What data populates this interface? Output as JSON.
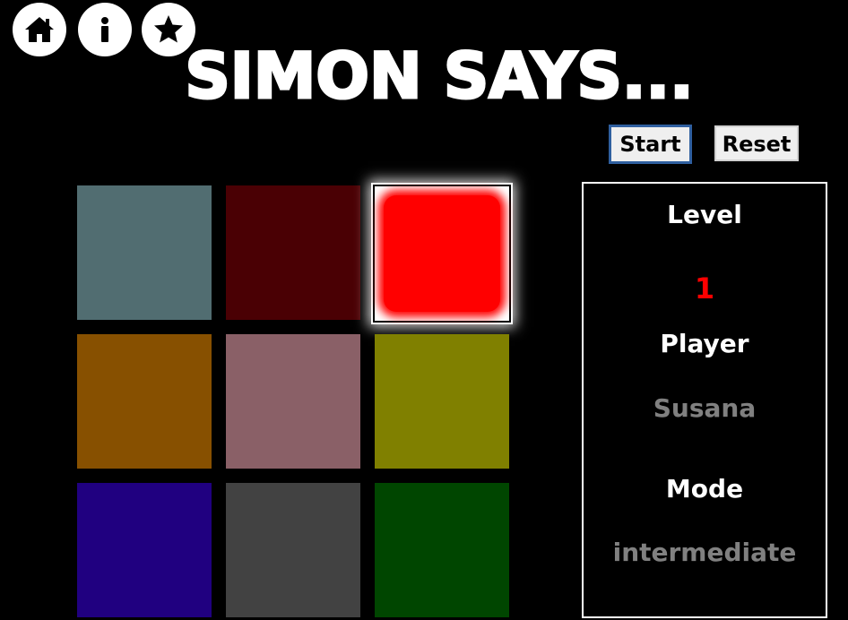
{
  "header": {
    "title": "SIMON SAYS...",
    "nav": [
      {
        "name": "home",
        "icon": "home-icon"
      },
      {
        "name": "info",
        "icon": "info-icon"
      },
      {
        "name": "favorites",
        "icon": "star-icon"
      }
    ]
  },
  "controls": {
    "start_label": "Start",
    "reset_label": "Reset"
  },
  "board": {
    "tiles": [
      {
        "color": "#516d71",
        "active": false
      },
      {
        "color": "#4a0004",
        "active": false
      },
      {
        "color": "#ff0000",
        "active": true
      },
      {
        "color": "#875000",
        "active": false
      },
      {
        "color": "#8a6067",
        "active": false
      },
      {
        "color": "#808000",
        "active": false
      },
      {
        "color": "#200080",
        "active": false
      },
      {
        "color": "#424242",
        "active": false
      },
      {
        "color": "#004600",
        "active": false
      }
    ]
  },
  "status": {
    "level_label": "Level",
    "level_value": "1",
    "level_color": "#ff0000",
    "player_label": "Player",
    "player_value": "Susana",
    "mode_label": "Mode",
    "mode_value": "intermediate",
    "value_color": "#808080"
  }
}
